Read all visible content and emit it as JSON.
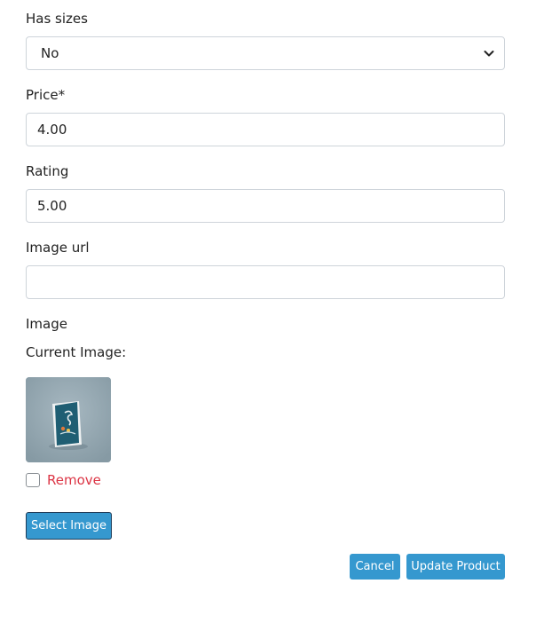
{
  "form": {
    "has_sizes": {
      "label": "Has sizes",
      "selected": "No"
    },
    "price": {
      "label": "Price*",
      "value": "4.00"
    },
    "rating": {
      "label": "Rating",
      "value": "5.00"
    },
    "image_url": {
      "label": "Image url",
      "value": ""
    },
    "image": {
      "label": "Image",
      "current_label": "Current Image:",
      "remove_label": "Remove",
      "remove_checked": false,
      "select_button": "Select Image"
    }
  },
  "actions": {
    "cancel": "Cancel",
    "update": "Update Product"
  },
  "colors": {
    "primary_button": "#3598cf",
    "remove_text": "#dc3545",
    "input_border": "#ced4da"
  },
  "icons": {
    "select_arrow": "chevron-down-icon"
  }
}
